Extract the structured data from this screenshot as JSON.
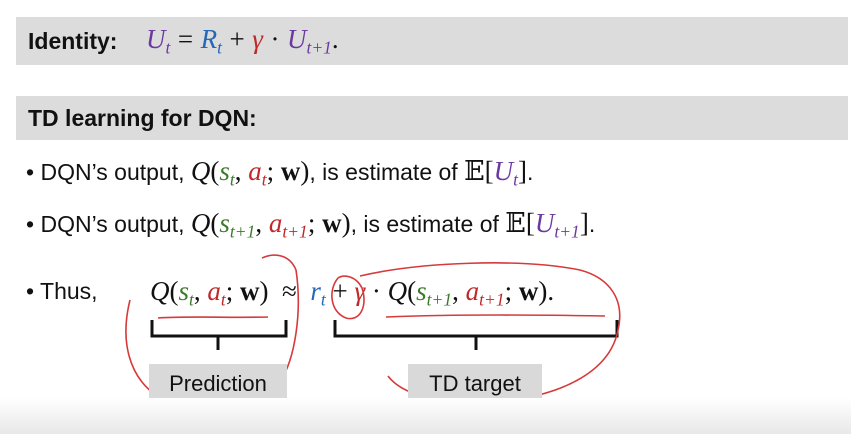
{
  "identity": {
    "label": "Identity:",
    "U": "U",
    "t": "t",
    "eq": "=",
    "R": "R",
    "plus": "+",
    "gamma": "γ",
    "dot": "·",
    "t1": "t+1",
    "period": "."
  },
  "td_section": {
    "label": "TD learning for DQN:"
  },
  "bullet1": {
    "bullet": "•",
    "prefix": "DQN’s output,",
    "mid": ", is estimate of",
    "end": "."
  },
  "bullet2": {
    "bullet": "•",
    "prefix": "DQN’s output,",
    "mid": ", is estimate of",
    "end": "."
  },
  "bullet3": {
    "bullet": "•",
    "prefix": "Thus,"
  },
  "math": {
    "Q": "Q",
    "s": "s",
    "a": "a",
    "r": "r",
    "w": "w",
    "t": "t",
    "t1": "t+1",
    "E": "𝔼",
    "U": "U",
    "approx": "≈",
    "plus": "+",
    "gamma": "γ",
    "dot": "·"
  },
  "labels": {
    "prediction": "Prediction",
    "td_target": "TD target"
  },
  "colors": {
    "state": "#3a7a2a",
    "action": "#c0282a",
    "reward": "#2468b8",
    "return": "#6b3aa0",
    "annotation": "#d63a3a",
    "band": "#dcdcdc"
  }
}
